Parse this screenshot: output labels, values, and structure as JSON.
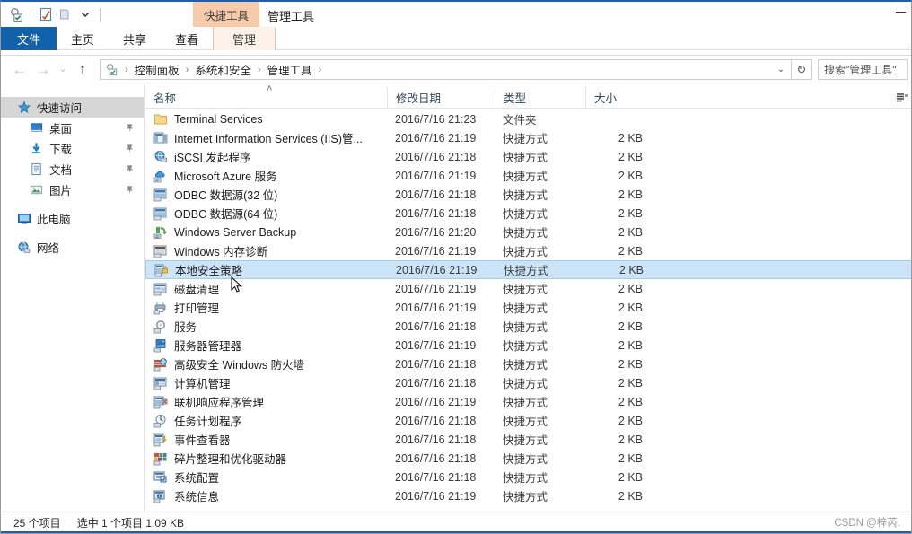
{
  "window": {
    "app": "file-explorer",
    "accent_color": "#1a5fb4"
  },
  "titlebar": {
    "qat": [
      {
        "name": "admin-tools-icon",
        "label": "管理工具"
      },
      {
        "name": "properties-icon",
        "label": "属性"
      },
      {
        "name": "new-folder-icon",
        "label": "新建文件夹"
      },
      {
        "name": "customize-qat-icon",
        "label": "自定义快速访问工具栏"
      }
    ],
    "contextual_group": "快捷工具",
    "window_title": "管理工具",
    "minimize_label": "最小化"
  },
  "ribbon": {
    "tabs": [
      {
        "label": "文件",
        "state": "file"
      },
      {
        "label": "主页",
        "state": "normal"
      },
      {
        "label": "共享",
        "state": "normal"
      },
      {
        "label": "查看",
        "state": "normal"
      },
      {
        "label": "管理",
        "state": "contextual"
      }
    ]
  },
  "addressbar": {
    "back_icon": "←",
    "forward_icon": "→",
    "recent_icon": "⌄",
    "up_icon": "↑",
    "crumbs": [
      "控制面板",
      "系统和安全",
      "管理工具"
    ],
    "separator": "›",
    "dropdown_icon": "⌄",
    "refresh_icon": "↻",
    "search_placeholder": "搜索\"管理工具\""
  },
  "sidebar": {
    "items": [
      {
        "label": "快速访问",
        "icon": "quick-access-star-icon",
        "selected": true,
        "pinned": false,
        "level": 0
      },
      {
        "label": "桌面",
        "icon": "desktop-icon",
        "selected": false,
        "pinned": true,
        "level": 1
      },
      {
        "label": "下载",
        "icon": "downloads-icon",
        "selected": false,
        "pinned": true,
        "level": 1
      },
      {
        "label": "文档",
        "icon": "documents-icon",
        "selected": false,
        "pinned": true,
        "level": 1
      },
      {
        "label": "图片",
        "icon": "pictures-icon",
        "selected": false,
        "pinned": true,
        "level": 1
      },
      {
        "label": "此电脑",
        "icon": "this-pc-icon",
        "selected": false,
        "pinned": false,
        "level": 0,
        "gap_before": true
      },
      {
        "label": "网络",
        "icon": "network-icon",
        "selected": false,
        "pinned": false,
        "level": 0,
        "gap_before": true
      }
    ]
  },
  "filelist": {
    "columns": [
      {
        "label": "名称",
        "sorted": "asc",
        "sort_glyph": "˄"
      },
      {
        "label": "修改日期"
      },
      {
        "label": "类型"
      },
      {
        "label": "大小"
      }
    ],
    "rows": [
      {
        "name": "Terminal Services",
        "date": "2016/7/16 21:23",
        "type": "文件夹",
        "size": "",
        "icon": "folder-icon",
        "selected": false
      },
      {
        "name": "Internet Information Services (IIS)管...",
        "date": "2016/7/16 21:19",
        "type": "快捷方式",
        "size": "2 KB",
        "icon": "iis-manager-icon",
        "selected": false
      },
      {
        "name": "iSCSI 发起程序",
        "date": "2016/7/16 21:18",
        "type": "快捷方式",
        "size": "2 KB",
        "icon": "iscsi-icon",
        "selected": false
      },
      {
        "name": "Microsoft Azure 服务",
        "date": "2016/7/16 21:19",
        "type": "快捷方式",
        "size": "2 KB",
        "icon": "azure-icon",
        "selected": false
      },
      {
        "name": "ODBC 数据源(32 位)",
        "date": "2016/7/16 21:18",
        "type": "快捷方式",
        "size": "2 KB",
        "icon": "odbc-icon",
        "selected": false
      },
      {
        "name": "ODBC 数据源(64 位)",
        "date": "2016/7/16 21:18",
        "type": "快捷方式",
        "size": "2 KB",
        "icon": "odbc-icon",
        "selected": false
      },
      {
        "name": "Windows Server Backup",
        "date": "2016/7/16 21:20",
        "type": "快捷方式",
        "size": "2 KB",
        "icon": "backup-icon",
        "selected": false
      },
      {
        "name": "Windows 内存诊断",
        "date": "2016/7/16 21:19",
        "type": "快捷方式",
        "size": "2 KB",
        "icon": "memory-diagnostic-icon",
        "selected": false
      },
      {
        "name": "本地安全策略",
        "date": "2016/7/16 21:19",
        "type": "快捷方式",
        "size": "2 KB",
        "icon": "local-security-policy-icon",
        "selected": true
      },
      {
        "name": "磁盘清理",
        "date": "2016/7/16 21:19",
        "type": "快捷方式",
        "size": "2 KB",
        "icon": "disk-cleanup-icon",
        "selected": false
      },
      {
        "name": "打印管理",
        "date": "2016/7/16 21:19",
        "type": "快捷方式",
        "size": "2 KB",
        "icon": "print-management-icon",
        "selected": false
      },
      {
        "name": "服务",
        "date": "2016/7/16 21:18",
        "type": "快捷方式",
        "size": "2 KB",
        "icon": "services-icon",
        "selected": false
      },
      {
        "name": "服务器管理器",
        "date": "2016/7/16 21:19",
        "type": "快捷方式",
        "size": "2 KB",
        "icon": "server-manager-icon",
        "selected": false
      },
      {
        "name": "高级安全 Windows 防火墙",
        "date": "2016/7/16 21:18",
        "type": "快捷方式",
        "size": "2 KB",
        "icon": "firewall-icon",
        "selected": false
      },
      {
        "name": "计算机管理",
        "date": "2016/7/16 21:18",
        "type": "快捷方式",
        "size": "2 KB",
        "icon": "computer-management-icon",
        "selected": false
      },
      {
        "name": "联机响应程序管理",
        "date": "2016/7/16 21:19",
        "type": "快捷方式",
        "size": "2 KB",
        "icon": "online-responder-icon",
        "selected": false
      },
      {
        "name": "任务计划程序",
        "date": "2016/7/16 21:18",
        "type": "快捷方式",
        "size": "2 KB",
        "icon": "task-scheduler-icon",
        "selected": false
      },
      {
        "name": "事件查看器",
        "date": "2016/7/16 21:18",
        "type": "快捷方式",
        "size": "2 KB",
        "icon": "event-viewer-icon",
        "selected": false
      },
      {
        "name": "碎片整理和优化驱动器",
        "date": "2016/7/16 21:18",
        "type": "快捷方式",
        "size": "2 KB",
        "icon": "defragment-icon",
        "selected": false
      },
      {
        "name": "系统配置",
        "date": "2016/7/16 21:18",
        "type": "快捷方式",
        "size": "2 KB",
        "icon": "system-config-icon",
        "selected": false
      },
      {
        "name": "系统信息",
        "date": "2016/7/16 21:19",
        "type": "快捷方式",
        "size": "2 KB",
        "icon": "system-info-icon",
        "selected": false
      }
    ]
  },
  "statusbar": {
    "item_count": "25 个项目",
    "selection": "选中 1 个项目  1.09 KB"
  },
  "watermark": "CSDN @梓芮."
}
